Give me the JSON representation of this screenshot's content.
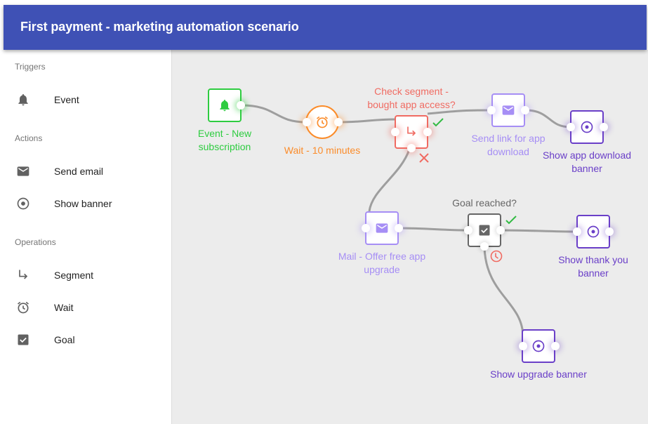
{
  "header": {
    "title": "First payment - marketing automation scenario"
  },
  "sidebar": {
    "sections": [
      {
        "label": "Triggers",
        "items": [
          {
            "label": "Event",
            "icon": "bell-icon"
          }
        ]
      },
      {
        "label": "Actions",
        "items": [
          {
            "label": "Send email",
            "icon": "mail-icon"
          },
          {
            "label": "Show banner",
            "icon": "radio-target-icon"
          }
        ]
      },
      {
        "label": "Operations",
        "items": [
          {
            "label": "Segment",
            "icon": "subdirectory-arrow-icon"
          },
          {
            "label": "Wait",
            "icon": "alarm-clock-icon"
          },
          {
            "label": "Goal",
            "icon": "checkbox-icon"
          }
        ]
      }
    ]
  },
  "colors": {
    "header": "#3f51b5",
    "event": "#2ecc40",
    "wait": "#fb8c2a",
    "segment": "#f06b62",
    "mail": "#a68ef5",
    "banner": "#6a3fc8",
    "goal": "#666666",
    "yes": "#33bb44",
    "no": "#f06b62",
    "edge": "#9e9e9e"
  },
  "nodes": [
    {
      "id": "event",
      "type": "event",
      "label_lines": [
        "Event - New",
        "subscription"
      ]
    },
    {
      "id": "wait",
      "type": "wait",
      "label_lines": [
        "Wait - 10 minutes"
      ]
    },
    {
      "id": "segment",
      "type": "segment",
      "label_lines": [
        "Check segment -",
        "bought app access?"
      ]
    },
    {
      "id": "sendlink",
      "type": "mail",
      "label_lines": [
        "Send link for app",
        "download"
      ]
    },
    {
      "id": "appbanner",
      "type": "banner",
      "label_lines": [
        "Show app download",
        "banner"
      ]
    },
    {
      "id": "mailoffer",
      "type": "mail",
      "label_lines": [
        "Mail - Offer free app",
        "upgrade"
      ]
    },
    {
      "id": "goal",
      "type": "goal",
      "label_lines": [
        "Goal reached?"
      ]
    },
    {
      "id": "thankyou",
      "type": "banner",
      "label_lines": [
        "Show thank you",
        "banner"
      ]
    },
    {
      "id": "upgrade",
      "type": "banner",
      "label_lines": [
        "Show upgrade banner"
      ]
    }
  ],
  "edges": [
    {
      "from": "event",
      "to": "wait"
    },
    {
      "from": "wait",
      "to": "segment"
    },
    {
      "from": "segment",
      "to": "sendlink",
      "branch": "yes"
    },
    {
      "from": "sendlink",
      "to": "appbanner"
    },
    {
      "from": "segment",
      "to": "mailoffer",
      "branch": "no"
    },
    {
      "from": "mailoffer",
      "to": "goal"
    },
    {
      "from": "goal",
      "to": "thankyou",
      "branch": "yes"
    },
    {
      "from": "goal",
      "to": "upgrade",
      "branch": "timeout"
    }
  ]
}
